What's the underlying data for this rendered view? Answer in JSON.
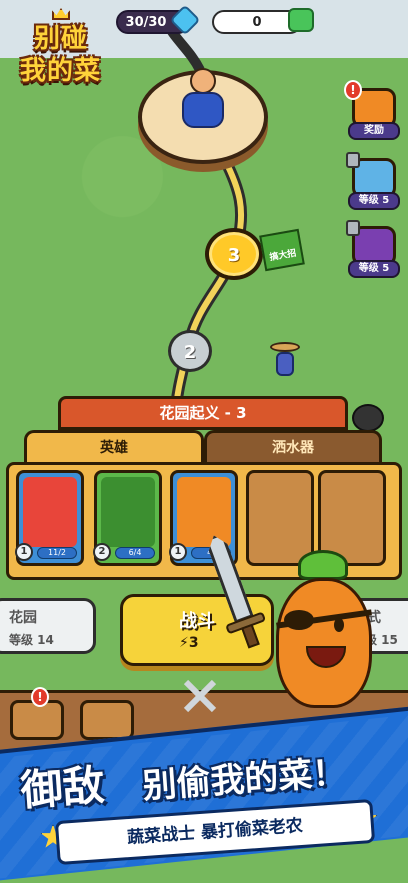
{
  "hud": {
    "energy": "30/30",
    "coins": "0"
  },
  "logo": {
    "line1": "别碰",
    "line2": "我的菜"
  },
  "map": {
    "node_current": "3",
    "node_next": "2",
    "tag_label": "搞大招"
  },
  "side_buttons": {
    "reward_label": "奖励",
    "level_label_1": "等级 5",
    "level_label_2": "等级 5"
  },
  "panel": {
    "title": "花园起义 - 3",
    "tab_hero": "英雄",
    "tab_sprinkler": "洒水器",
    "cards": [
      {
        "level": "1",
        "count": "11/2"
      },
      {
        "level": "2",
        "count": "6/4"
      },
      {
        "level": "1",
        "count": "4/"
      }
    ]
  },
  "bottom": {
    "garden_title": "花园",
    "garden_level": "等级 14",
    "fight_title": "战斗",
    "fight_cost": "3",
    "right_title": "式",
    "right_level": "等级 15"
  },
  "banner": {
    "slogan_big": "御敌",
    "slogan_rest": "别偷我的菜！",
    "subtitle": "蔬菜战士 暴打偷菜老农"
  },
  "colors": {
    "accent_orange": "#d9572b",
    "panel_gold": "#f1b84a",
    "banner_blue": "#1f6fd6",
    "fight_yellow": "#f6d33a"
  }
}
